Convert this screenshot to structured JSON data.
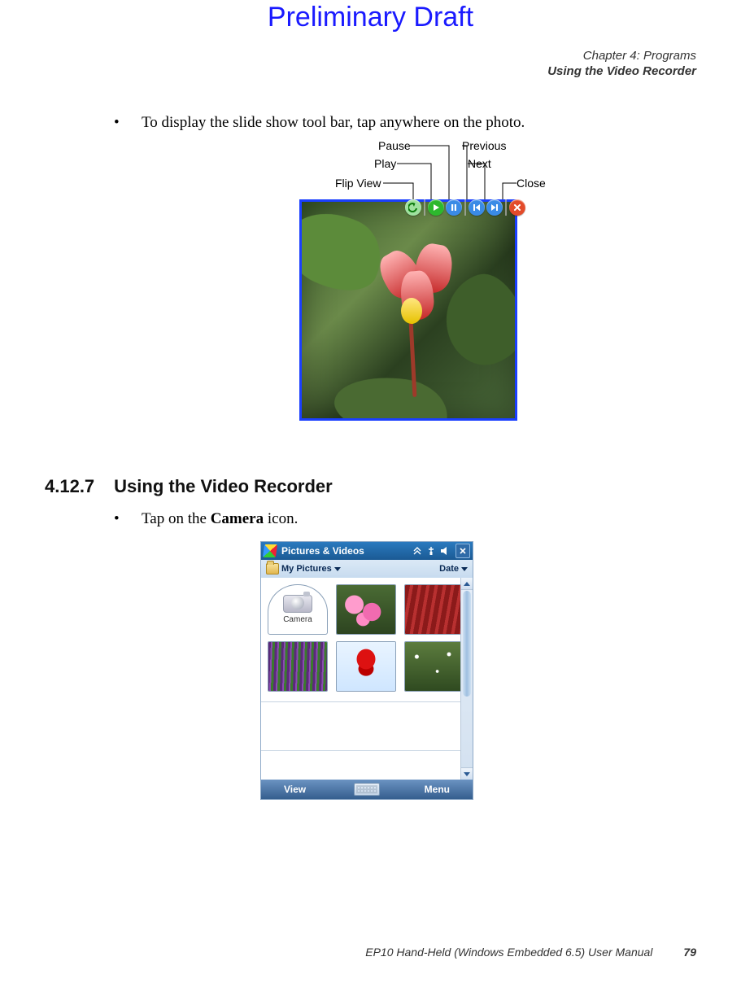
{
  "watermark": "Preliminary Draft",
  "header": {
    "chapter_line": "Chapter 4: Programs",
    "section_line": "Using the Video Recorder"
  },
  "body": {
    "bullet1_prefix": "•",
    "bullet1_text": "To display the slide show tool bar, tap anywhere on the photo.",
    "bullet2_prefix": "•",
    "bullet2_text_a": "Tap on the ",
    "bullet2_text_b": "Camera",
    "bullet2_text_c": " icon."
  },
  "section": {
    "number": "4.12.7",
    "title": "Using the Video Recorder"
  },
  "slideshow_toolbar": {
    "labels": {
      "flip_view": "Flip View",
      "play": "Play",
      "pause": "Pause",
      "previous": "Previous",
      "next": "Next",
      "close": "Close"
    },
    "buttons": [
      "flip-view",
      "play",
      "pause",
      "previous",
      "next",
      "close"
    ]
  },
  "pictures_app": {
    "title": "Pictures & Videos",
    "status_icons": [
      "connectivity",
      "signal",
      "volume"
    ],
    "close_label": "X",
    "subbar": {
      "folder_label": "My Pictures",
      "sort_label": "Date"
    },
    "thumbnails": {
      "camera_label": "Camera"
    },
    "bottombar": {
      "left": "View",
      "right": "Menu"
    }
  },
  "footer": {
    "manual_title": "EP10 Hand-Held (Windows Embedded 6.5) User Manual",
    "page_number": "79"
  }
}
